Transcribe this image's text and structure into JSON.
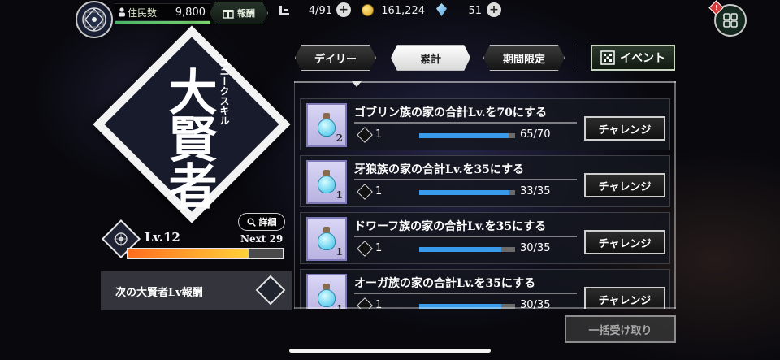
{
  "topbar": {
    "population_label": "住民数",
    "population_value": "9,800",
    "reward_label": "報酬",
    "slots_value": "4/91",
    "gold_value": "161,224",
    "crystal_value": "51",
    "alert_badge": "!"
  },
  "skill": {
    "name": "大賢者",
    "category": "ユニークスキル",
    "detail_label": "詳細",
    "level": "Lv.12",
    "next_label": "Next 29",
    "level_progress": 0.78,
    "next_reward_label": "次の大賢者Lv報酬"
  },
  "tabs": {
    "daily": "デイリー",
    "cumulative": "累計",
    "limited": "期間限定",
    "event": "イベント"
  },
  "missions": [
    {
      "title": "ゴブリン族の家の合計Lv.を70にする",
      "item_count": "2",
      "points": "1",
      "progress_text": "65/70",
      "progress": 0.93,
      "button": "チャレンジ"
    },
    {
      "title": "牙狼族の家の合計Lv.を35にする",
      "item_count": "1",
      "points": "1",
      "progress_text": "33/35",
      "progress": 0.94,
      "button": "チャレンジ"
    },
    {
      "title": "ドワーフ族の家の合計Lv.を35にする",
      "item_count": "1",
      "points": "1",
      "progress_text": "30/35",
      "progress": 0.86,
      "button": "チャレンジ"
    },
    {
      "title": "オーガ族の家の合計Lv.を35にする",
      "item_count": "1",
      "points": "1",
      "progress_text": "30/35",
      "progress": 0.86,
      "button": "チャレンジ"
    }
  ],
  "bulk_receive_label": "一括受け取り",
  "colors": {
    "accent_green": "#47b36a",
    "progress_blue": "#3a9bea",
    "level_orange": "#ff6d1f",
    "level_yellow": "#ffd23a"
  }
}
